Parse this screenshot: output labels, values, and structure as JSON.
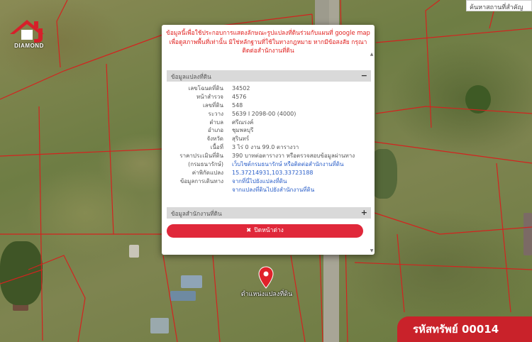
{
  "logo": {
    "text": "DIAMOND"
  },
  "search": {
    "label": "ค้นหาสถานที่สำคัญ"
  },
  "popup": {
    "notice": "ข้อมูลนี้เพื่อใช้ประกอบการแสดงลักษณะรูปแปลงที่ดินร่วมกับแผนที่ google map เพื่อดูสภาพพื้นที่เท่านั้น มิใช่หลักฐานที่ใช้ในทางกฎหมาย หากมีข้อสงสัย กรุณาติดต่อสำนักงานที่ดิน",
    "section1_title": "ข้อมูลแปลงที่ดิน",
    "section1_toggle": "−",
    "rows": [
      {
        "label": "เลขโฉนดที่ดิน",
        "value": "34502"
      },
      {
        "label": "หน้าสำรวจ",
        "value": "4576"
      },
      {
        "label": "เลขที่ดิน",
        "value": "548"
      },
      {
        "label": "ระวาง",
        "value": "5639 I 2098-00 (4000)"
      },
      {
        "label": "ตำบล",
        "value": "ศรีณรงค์"
      },
      {
        "label": "อำเภอ",
        "value": "ชุมพลบุรี"
      },
      {
        "label": "จังหวัด",
        "value": "สุรินทร์"
      },
      {
        "label": "เนื้อที่",
        "value": "3 ไร่ 0 งาน 99.0 ตารางวา"
      },
      {
        "label": "ราคาประเมินที่ดิน",
        "value": "390 บาทต่อตารางวา หรือตรวจสอบข้อมูลผ่านทาง"
      },
      {
        "label": "(กรมธนารักษ์)",
        "value": "เว็บไซต์กรมธนารักษ์ หรือติดต่อสำนักงานที่ดิน"
      },
      {
        "label": "ค่าพิกัดแปลง",
        "value": "15.37214931,103.33723188"
      },
      {
        "label": "ข้อมูลการเดินทาง",
        "value": "จากที่นี่ไปยังแปลงที่ดิน"
      },
      {
        "label": "",
        "value": "จากแปลงที่ดินไปยังสำนักงานที่ดิน"
      }
    ],
    "section2_title": "ข้อมูลสำนักงานที่ดิน",
    "section2_toggle": "+",
    "close_label": "ปิดหน้าต่าง",
    "close_icon": "✖"
  },
  "marker": {
    "label": "ตำแหน่งแปลงที่ดิน"
  },
  "badge": {
    "text": "รหัสทรัพย์ 00014"
  },
  "colors": {
    "accent": "#e0283a",
    "notice": "#e0201e",
    "link": "#2c60c9",
    "badge": "#c9222a"
  }
}
